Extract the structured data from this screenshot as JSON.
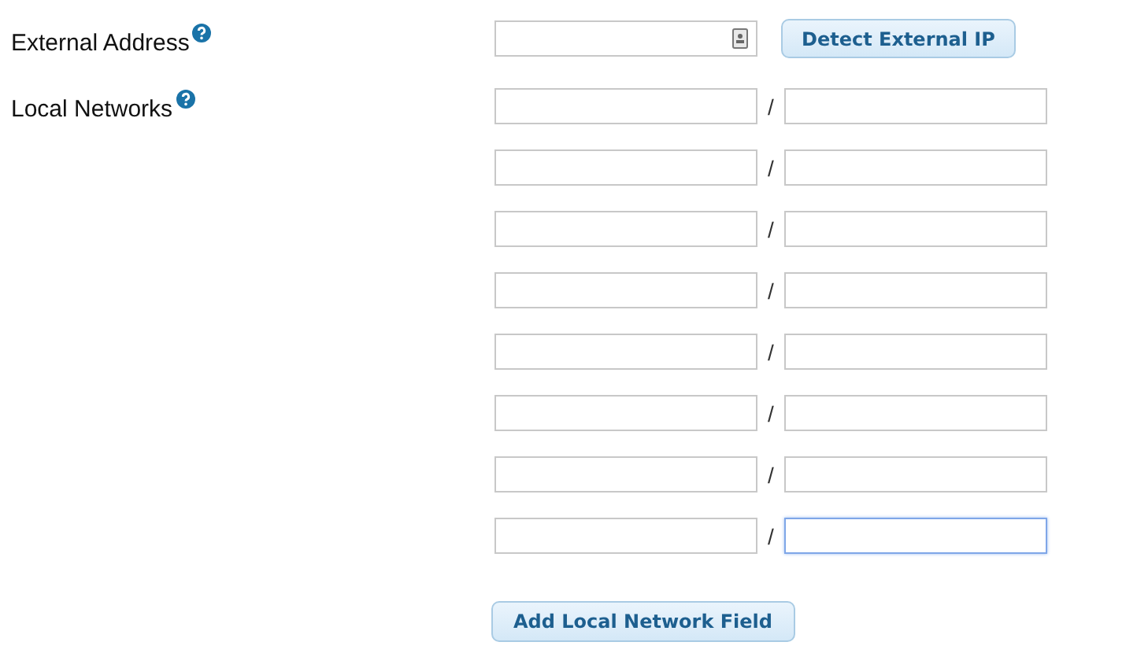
{
  "external_address": {
    "label": "External Address",
    "field": {
      "focused": false
    },
    "button": "Detect External IP"
  },
  "local_networks": {
    "label": "Local Networks",
    "separator": "/",
    "rows": [
      {
        "address": {
          "focused": false
        },
        "mask": {
          "focused": false
        }
      },
      {
        "address": {
          "focused": false
        },
        "mask": {
          "focused": false
        }
      },
      {
        "address": {
          "focused": false
        },
        "mask": {
          "focused": false
        }
      },
      {
        "address": {
          "focused": false
        },
        "mask": {
          "focused": false
        }
      },
      {
        "address": {
          "focused": false
        },
        "mask": {
          "focused": false
        }
      },
      {
        "address": {
          "focused": false
        },
        "mask": {
          "focused": false
        }
      },
      {
        "address": {
          "focused": false
        },
        "mask": {
          "focused": false
        }
      },
      {
        "address": {
          "focused": false
        },
        "mask": {
          "focused": true
        }
      }
    ],
    "add_button": "Add Local Network Field"
  }
}
